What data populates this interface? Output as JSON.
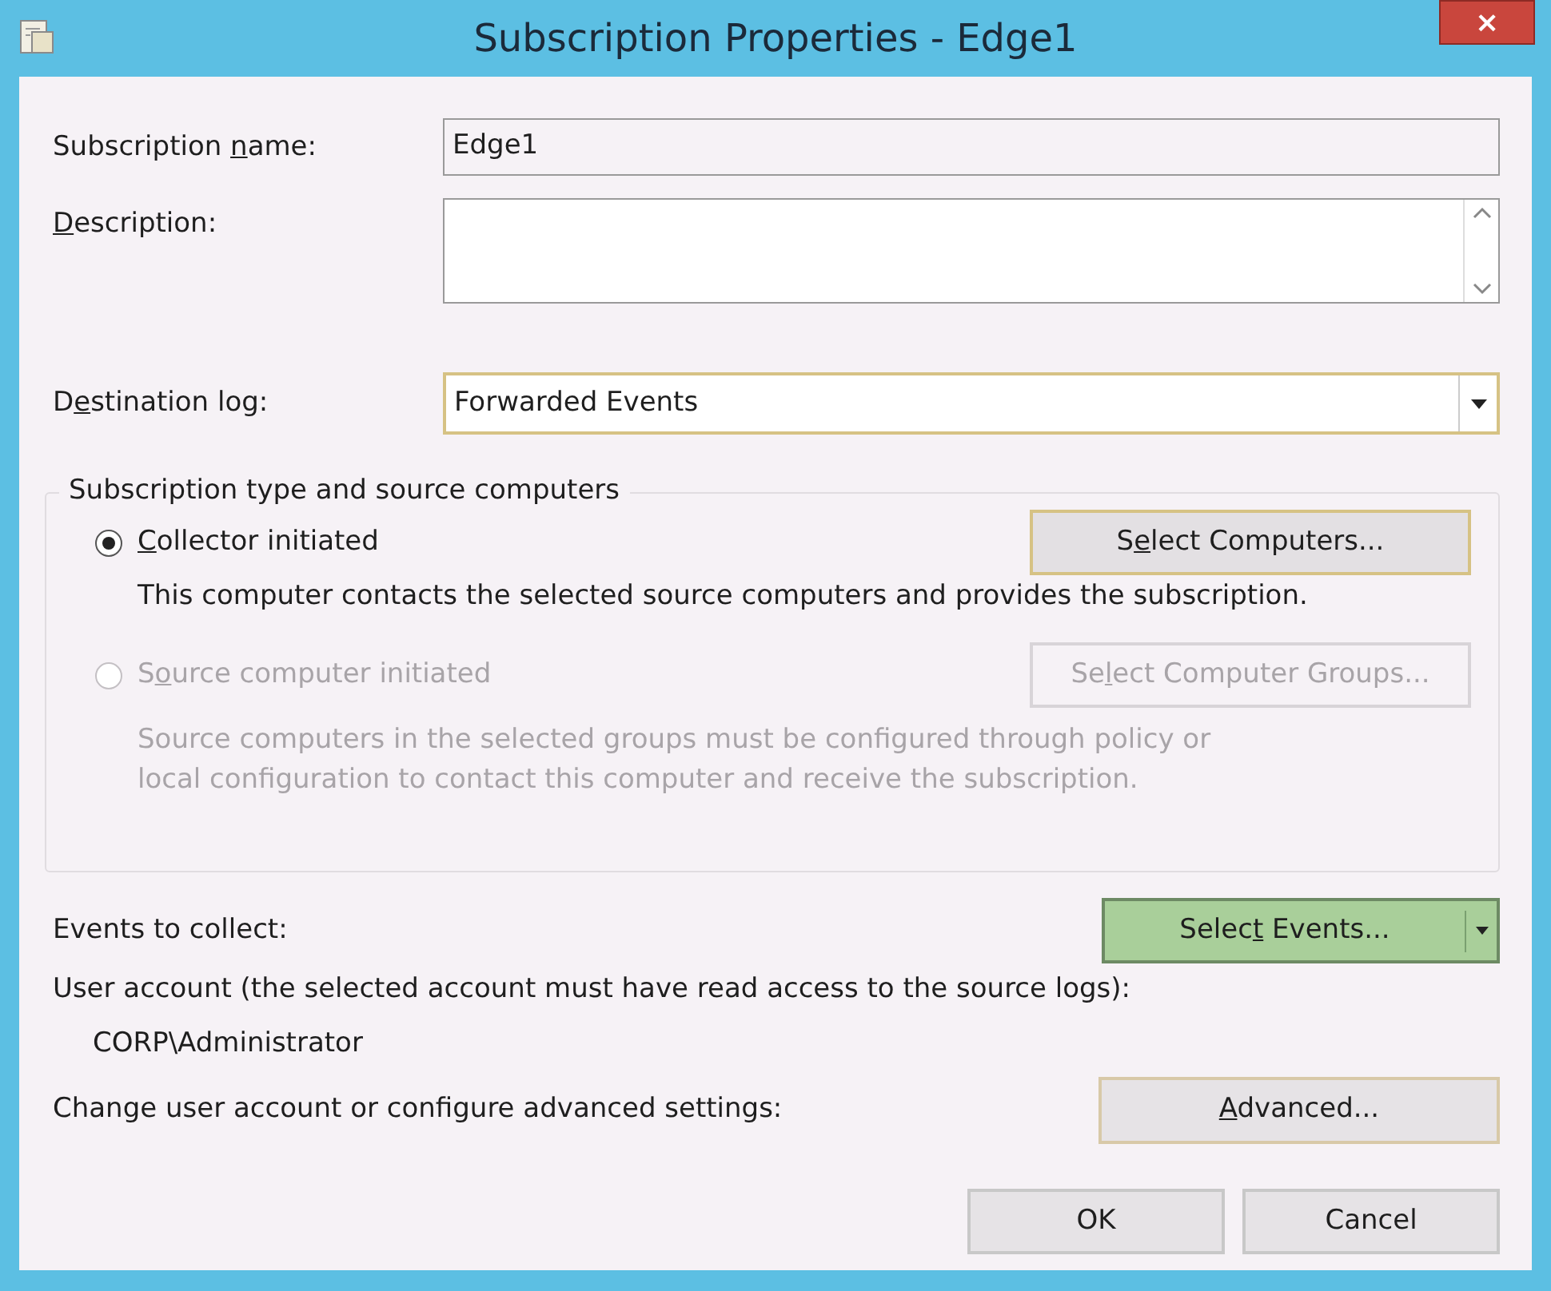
{
  "window": {
    "title": "Subscription Properties - Edge1",
    "close": "×"
  },
  "subscription_name": {
    "label": {
      "before": "Subscription ",
      "key": "n",
      "after": "ame:"
    },
    "value": "Edge1"
  },
  "description": {
    "label": {
      "key": "D",
      "after": "escription:"
    }
  },
  "destination_log": {
    "label": {
      "before": "D",
      "key": "e",
      "after": "stination log:"
    },
    "value": "Forwarded Events",
    "focused": true
  },
  "source_group": {
    "title": "Subscription type and source computers",
    "options": [
      {
        "label": {
          "key": "C",
          "after": "ollector initiated"
        },
        "selected": true,
        "disabled": false,
        "button": {
          "label": {
            "before": "S",
            "key": "e",
            "after": "lect Computers..."
          },
          "focused": true
        },
        "note": [
          "This computer contacts the selected source computers and provides the subscription."
        ]
      },
      {
        "label": {
          "before": "S",
          "key": "o",
          "after": "urce computer initiated"
        },
        "selected": false,
        "disabled": true,
        "button": {
          "label": {
            "before": "Se",
            "key": "l",
            "after": "ect Computer Groups..."
          },
          "focused": false
        },
        "note": [
          "Source computers in the selected groups must be configured through policy or",
          "local configuration to contact this computer and receive the subscription."
        ]
      }
    ]
  },
  "events": {
    "label": "Events to collect:",
    "button": {
      "label": {
        "before": "Selec",
        "key": "t",
        "after": " Events..."
      },
      "hovered": true
    }
  },
  "user_account": {
    "label": "User account (the selected account must have read access to the source logs):",
    "value": "CORP\\Administrator"
  },
  "advanced": {
    "label": "Change user account or configure advanced settings:",
    "button": {
      "label": {
        "key": "A",
        "after": "dvanced..."
      }
    }
  },
  "buttons": [
    {
      "label": "OK"
    },
    {
      "label": "Cancel"
    }
  ]
}
